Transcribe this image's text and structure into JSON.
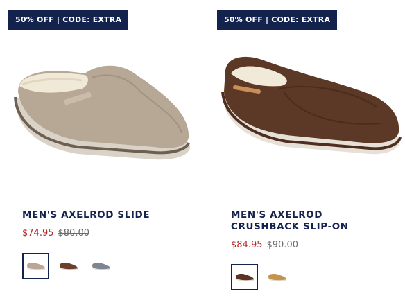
{
  "products": [
    {
      "promo": "50% OFF | CODE: EXTRA",
      "title": "MEN'S AXELROD SLIDE",
      "sale_price": "$74.95",
      "original_price": "$80.00",
      "image_icon": "taupe-suede-slide-icon",
      "swatches": [
        {
          "color": "#b9a794",
          "name": "taupe",
          "selected": true
        },
        {
          "color": "#6b3f2a",
          "name": "brown",
          "selected": false
        },
        {
          "color": "#7d8591",
          "name": "grey",
          "selected": false
        }
      ]
    },
    {
      "promo": "50% OFF | CODE: EXTRA",
      "title_line_1": "MEN'S AXELROD",
      "title_line_2": "CRUSHBACK SLIP-ON",
      "sale_price": "$84.95",
      "original_price": "$90.00",
      "image_icon": "brown-suede-slip-on-icon",
      "swatches": [
        {
          "color": "#5a3524",
          "name": "brown",
          "selected": true
        },
        {
          "color": "#c4934f",
          "name": "tan",
          "selected": false
        }
      ]
    }
  ],
  "colors": {
    "navy": "#13234d",
    "sale_red": "#b3262b",
    "strike_grey": "#6b6b6b"
  }
}
